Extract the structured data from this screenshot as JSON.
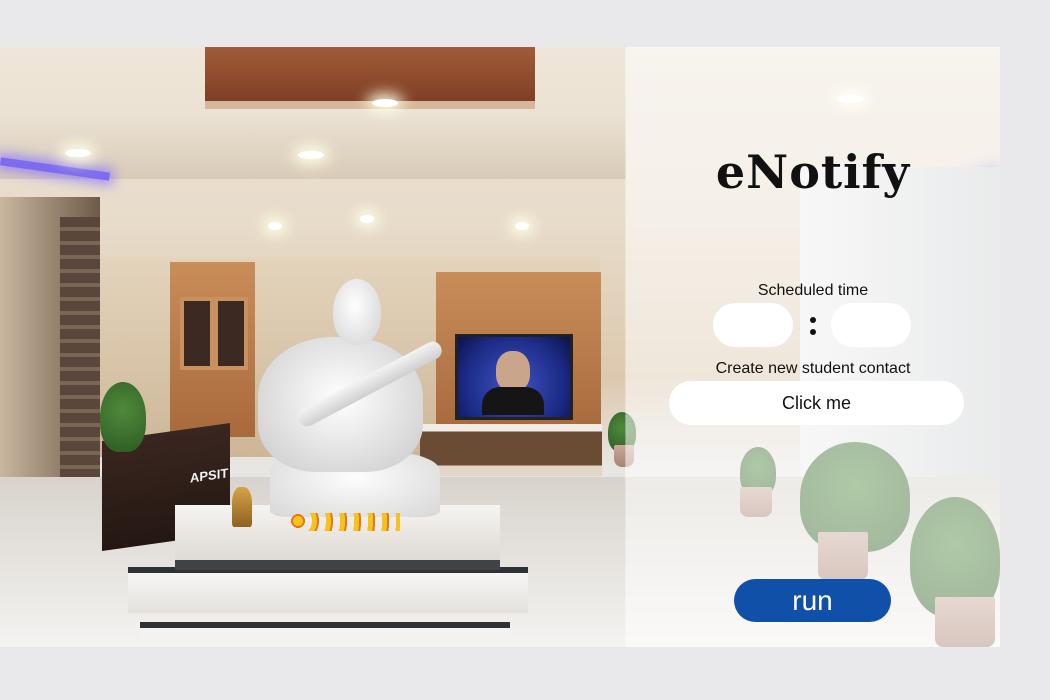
{
  "app": {
    "title": "eNotify"
  },
  "schedule": {
    "label": "Scheduled time",
    "hour_value": "",
    "minute_value": ""
  },
  "contact": {
    "label": "Create new student contact",
    "button_label": "Click me"
  },
  "actions": {
    "run_label": "run"
  },
  "background": {
    "signage_text": "APSIT"
  },
  "colors": {
    "run_button": "#1150a8",
    "panel_overlay": "rgba(255,255,255,0.55)",
    "page_background": "#e9e9eb"
  }
}
